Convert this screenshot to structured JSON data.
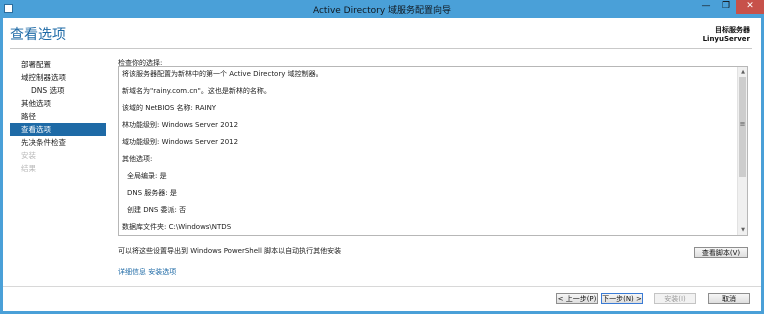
{
  "window": {
    "title": "Active Directory 域服务配置向导",
    "minimize_glyph": "—",
    "maximize_glyph": "❐",
    "close_glyph": "✕"
  },
  "header": {
    "page_title": "查看选项",
    "target_server_label": "目标服务器",
    "target_server_value": "LinyuServer"
  },
  "nav": {
    "items": [
      {
        "label": "部署配置",
        "state": "normal"
      },
      {
        "label": "域控制器选项",
        "state": "normal"
      },
      {
        "label": "DNS 选项",
        "state": "normal"
      },
      {
        "label": "其他选项",
        "state": "normal"
      },
      {
        "label": "路径",
        "state": "normal"
      },
      {
        "label": "查看选项",
        "state": "active"
      },
      {
        "label": "先决条件检查",
        "state": "normal"
      },
      {
        "label": "安装",
        "state": "disabled"
      },
      {
        "label": "结果",
        "state": "disabled"
      }
    ]
  },
  "review": {
    "section_label": "检查你的选择:",
    "lines": [
      "将该服务器配置为新林中的第一个 Active Directory 域控制器。",
      "新域名为\"rainy.com.cn\"。这也是新林的名称。",
      "该域的 NetBIOS 名称: RAINY",
      "林功能级别: Windows Server 2012",
      "域功能级别: Windows Server 2012",
      "其他选项:",
      "全局编录: 是",
      "DNS 服务器: 是",
      "创建 DNS 委派: 否",
      "数据库文件夹: C:\\Windows\\NTDS"
    ]
  },
  "export_note": "可以将这些设置导出到 Windows PowerShell 脚本以自动执行其他安装",
  "view_script_button": "查看脚本(V)",
  "more_link": "详细信息 安装选项",
  "footer": {
    "prev": "< 上一步(P)",
    "next": "下一步(N) >",
    "install": "安装(I)",
    "cancel": "取消"
  },
  "colors": {
    "titlebar": "#4aa0d8",
    "accent": "#1e6aa6",
    "close": "#c7514a"
  }
}
